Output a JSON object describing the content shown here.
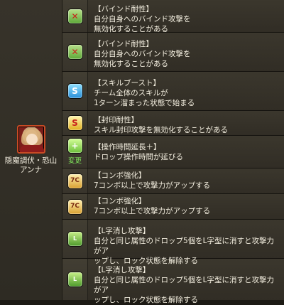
{
  "character": {
    "name": "隠魔調伏・恐山\nアンナ",
    "accent": "#c84a25"
  },
  "awakenings": [
    {
      "icon": "bind-resist-icon",
      "title": "【バインド耐性】",
      "desc": "自分自身へのバインド攻撃を\n無効化することがある",
      "symbol": "✕"
    },
    {
      "icon": "bind-resist-icon",
      "title": "【バインド耐性】",
      "desc": "自分自身へのバインド攻撃を\n無効化することがある",
      "symbol": "✕"
    },
    {
      "icon": "skill-boost-icon",
      "title": "【スキルブースト】",
      "desc": "チーム全体のスキルが\n1ターン溜まった状態で始まる",
      "symbol": "S"
    },
    {
      "icon": "seal-resist-icon",
      "title": "【封印耐性】",
      "desc": "スキル封印攻撃を無効化することがある",
      "symbol": "S"
    },
    {
      "icon": "extend-time-icon",
      "title": "【操作時間延長＋】",
      "desc": "ドロップ操作時間が延びる",
      "symbol": "+",
      "change": "変更"
    },
    {
      "icon": "combo-boost-icon",
      "title": "【コンボ強化】",
      "desc": "7コンボ以上で攻撃力がアップする",
      "symbol": "7C"
    },
    {
      "icon": "combo-boost-icon",
      "title": "【コンボ強化】",
      "desc": "7コンボ以上で攻撃力がアップする",
      "symbol": "7C"
    },
    {
      "icon": "l-shape-icon",
      "title": "【L字消し攻撃】",
      "desc": "自分と同じ属性のドロップ5個をL字型に消すと攻撃力がア\nップし、ロック状態を解除する",
      "symbol": "L"
    },
    {
      "icon": "l-shape-icon",
      "title": "【L字消し攻撃】",
      "desc": "自分と同じ属性のドロップ5個をL字型に消すと攻撃力がア\nップし、ロック状態を解除する",
      "symbol": "L"
    }
  ]
}
